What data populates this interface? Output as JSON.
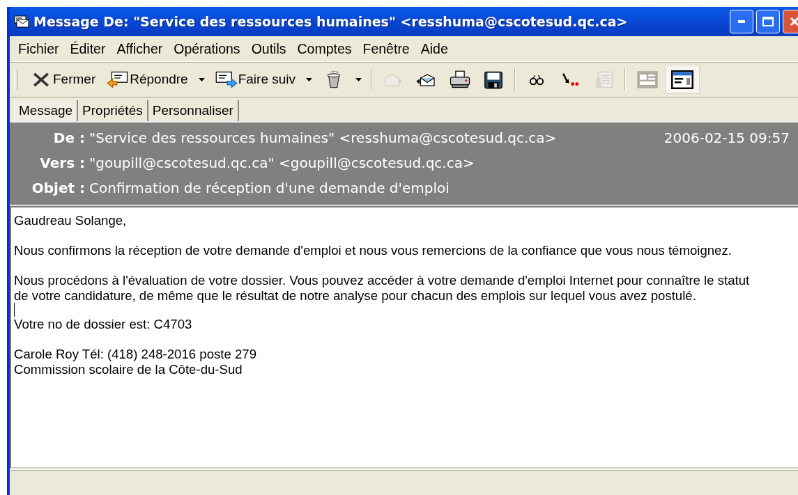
{
  "window": {
    "title": "Message De: \"Service des ressources humaines\" <resshuma@cscotesud.qc.ca>"
  },
  "menu": [
    "Fichier",
    "Éditer",
    "Afficher",
    "Opérations",
    "Outils",
    "Comptes",
    "Fenêtre",
    "Aide"
  ],
  "toolbar": [
    {
      "kind": "button",
      "label": "Fermer",
      "disabled": false
    },
    {
      "kind": "button",
      "label": "Répondre",
      "disabled": false
    },
    {
      "kind": "caret",
      "disabled": false
    },
    {
      "kind": "button",
      "label": "Faire suiv",
      "disabled": false
    },
    {
      "kind": "caret",
      "disabled": false
    },
    {
      "kind": "icon",
      "disabled": false
    },
    {
      "kind": "caret",
      "disabled": false
    },
    {
      "kind": "separator"
    },
    {
      "kind": "icon",
      "disabled": true
    },
    {
      "kind": "icon",
      "disabled": false
    },
    {
      "kind": "icon",
      "disabled": false
    },
    {
      "kind": "icon",
      "disabled": false
    },
    {
      "kind": "separator"
    },
    {
      "kind": "icon",
      "disabled": false
    },
    {
      "kind": "icon",
      "disabled": false
    },
    {
      "kind": "icon",
      "disabled": true
    },
    {
      "kind": "separator"
    },
    {
      "kind": "toggle",
      "selected": false
    },
    {
      "kind": "toggle",
      "selected": true
    }
  ],
  "tabs": [
    {
      "label": "Message",
      "selected": true
    },
    {
      "label": "Propriétés",
      "selected": false
    },
    {
      "label": "Personnaliser",
      "selected": false
    }
  ],
  "header": {
    "fields": [
      {
        "label": "De :",
        "value": "\"Service des ressources humaines\" <resshuma@cscotesud.qc.ca>",
        "date": "2006-02-15 09:57"
      },
      {
        "label": "Vers :",
        "value": "\"goupill@cscotesud.qc.ca\" <goupill@cscotesud.qc.ca>"
      },
      {
        "label": "Objet :",
        "value": "Confirmation de réception d'une demande d'emploi"
      }
    ]
  },
  "body": {
    "paragraphs": [
      {
        "lines": [
          "Gaudreau Solange,"
        ]
      },
      {
        "lines": [
          "Nous confirmons la réception de votre demande d'emploi et nous vous remercions de la confiance que vous nous témoignez."
        ]
      },
      {
        "lines": [
          "Nous procédons à l'évaluation de votre dossier. Vous pouvez accéder à votre demande d'emploi Internet pour connaître le statut",
          "de votre candidature, de même que le résultat de notre analyse pour chacun des emplois sur lequel vous avez postulé."
        ],
        "cursor": true
      },
      {
        "lines": [
          "Votre no de dossier est: C4703"
        ]
      },
      {
        "lines": [
          "Carole Roy Tél: (418) 248-2016 poste 279",
          "Commission scolaire de la Côte-du-Sud"
        ]
      }
    ]
  }
}
